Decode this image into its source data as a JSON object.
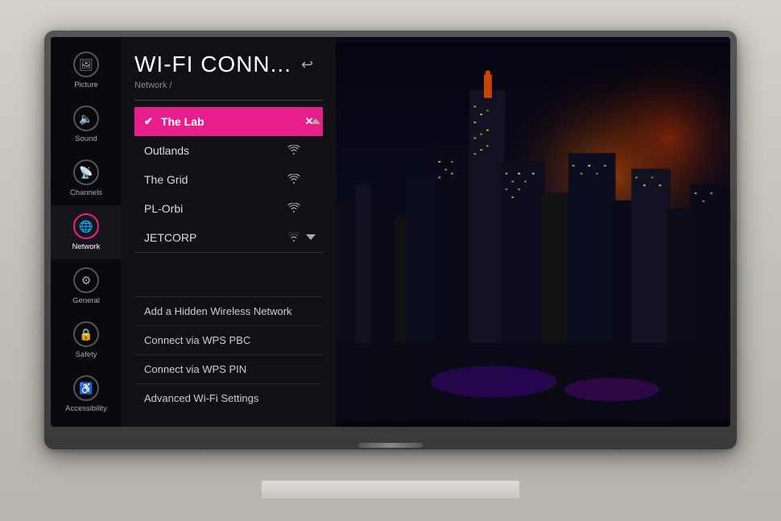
{
  "room": {
    "bg_color": "#c8c4be"
  },
  "tv": {
    "title": "WI-FI CONN...",
    "breadcrumb": "Network /",
    "back_label": "↩"
  },
  "sidebar": {
    "items": [
      {
        "id": "picture",
        "label": "Picture",
        "icon": "🖼",
        "active": false
      },
      {
        "id": "sound",
        "label": "Sound",
        "icon": "🔈",
        "active": false
      },
      {
        "id": "channels",
        "label": "Channels",
        "icon": "📡",
        "active": false
      },
      {
        "id": "network",
        "label": "Network",
        "icon": "🌐",
        "active": true
      },
      {
        "id": "general",
        "label": "General",
        "icon": "⚙",
        "active": false
      },
      {
        "id": "safety",
        "label": "Safety",
        "icon": "🔒",
        "active": false
      },
      {
        "id": "accessibility",
        "label": "Accessibility",
        "icon": "♿",
        "active": false
      }
    ]
  },
  "wifi": {
    "networks": [
      {
        "name": "The Lab",
        "selected": true,
        "has_wifi_icon": false,
        "has_close": true
      },
      {
        "name": "Outlands",
        "selected": false,
        "has_wifi_icon": true
      },
      {
        "name": "The Grid",
        "selected": false,
        "has_wifi_icon": true
      },
      {
        "name": "PL-Orbi",
        "selected": false,
        "has_wifi_icon": true
      },
      {
        "name": "JETCORP",
        "selected": false,
        "has_wifi_icon": true,
        "partial": true
      }
    ],
    "bottom_items": [
      "Add a Hidden Wireless Network",
      "Connect via WPS PBC",
      "Connect via WPS PIN",
      "Advanced Wi-Fi Settings"
    ]
  }
}
